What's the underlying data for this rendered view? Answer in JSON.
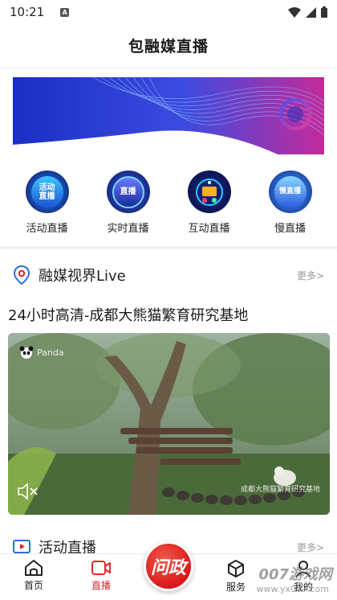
{
  "status_bar": {
    "time": "10:21",
    "a_badge": "A"
  },
  "header": {
    "title": "包融媒直播"
  },
  "categories": [
    {
      "icon_text": "活动\n直播",
      "label": "活动直播",
      "icon": "activity-live-icon"
    },
    {
      "icon_text": "直播",
      "label": "实时直播",
      "icon": "realtime-live-icon"
    },
    {
      "icon_text": "",
      "label": "互动直播",
      "icon": "interactive-live-icon"
    },
    {
      "icon_text": "慢直播",
      "label": "慢直播",
      "icon": "slow-live-icon"
    }
  ],
  "section1": {
    "title": "融媒视界Live",
    "more": "更多>"
  },
  "video": {
    "title": "24小时高清-成都大熊猫繁育研究基地",
    "logo_text": "Panda",
    "caption": "成都大熊猫繁育研究基地"
  },
  "section2": {
    "title": "活动直播",
    "more": "更多>"
  },
  "tabbar": {
    "home": "首页",
    "live": "直播",
    "center": "问政",
    "service": "服务",
    "mine": "我的"
  },
  "watermark": {
    "main": "007游戏网",
    "sub": "www.yx007.com"
  },
  "colors": {
    "accent_red": "#e0282a",
    "banner_blue": "#1f3fd0",
    "banner_pink": "#e0288a"
  }
}
